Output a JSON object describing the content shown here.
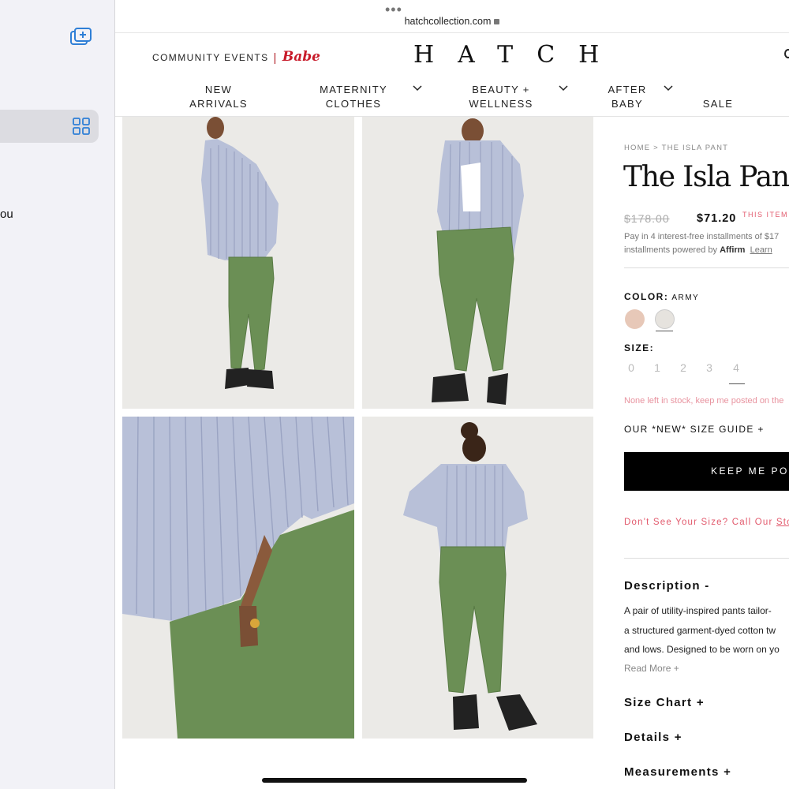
{
  "browser": {
    "url": "hatchcollection.com",
    "sidebar_partial_text": "ou"
  },
  "header": {
    "community_events": "COMMUNITY EVENTS",
    "separator": "|",
    "babe_logo": "Babe",
    "logo": "HATCH",
    "nav": [
      {
        "line1": "NEW",
        "line2": "ARRIVALS",
        "has_dropdown": false
      },
      {
        "line1": "MATERNITY",
        "line2": "CLOTHES",
        "has_dropdown": true
      },
      {
        "line1": "BEAUTY +",
        "line2": "WELLNESS",
        "has_dropdown": true
      },
      {
        "line1": "AFTER",
        "line2": "BABY",
        "has_dropdown": true
      },
      {
        "line1": "",
        "line2": "SALE",
        "has_dropdown": false
      }
    ]
  },
  "product": {
    "breadcrumb": {
      "home": "HOME",
      "sep": " > ",
      "current": "THE ISLA PANT"
    },
    "title": "The Isla Pant",
    "price_original": "$178.00",
    "price_sale": "$71.20",
    "price_note": "THIS ITEM",
    "affirm_line1": "Pay in 4 interest-free installments of $17",
    "affirm_line2_prefix": "installments powered by ",
    "affirm_brand": "Affirm",
    "affirm_learn": "Learn",
    "color_label": "COLOR:",
    "color_value": "ARMY",
    "swatches": [
      "#e7c8b8",
      "#e6e3de"
    ],
    "size_label": "SIZE:",
    "sizes": [
      "0",
      "1",
      "2",
      "3",
      "4"
    ],
    "stock_message": "None left in stock, keep me posted on the",
    "size_guide": "OUR *NEW* SIZE GUIDE +",
    "keep_button": "KEEP ME POST",
    "dont_see_prefix": "Don't See Your Size? Call Our ",
    "dont_see_link": "Stor",
    "description_heading": "Description -",
    "description_lines": [
      "A pair of utility-inspired pants tailor-",
      "a structured garment-dyed cotton tw",
      "and lows. Designed to be worn on yo"
    ],
    "read_more": "Read More +",
    "accordions": [
      "Size Chart +",
      "Details +",
      "Measurements +"
    ]
  },
  "colors": {
    "accent_red": "#c81b2a",
    "sale_pink": "#e25a6d",
    "safari_blue": "#2f7fd6",
    "shirt_blue": "#b8c0d8",
    "pant_green": "#6b8f55"
  }
}
